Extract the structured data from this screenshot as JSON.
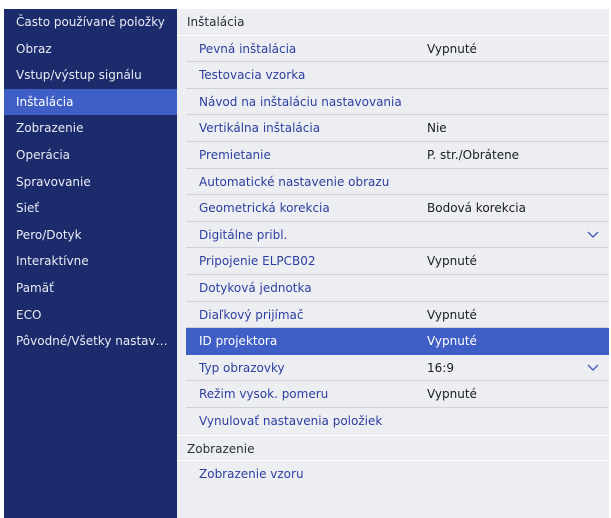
{
  "sidebar": {
    "items": [
      {
        "label": "Často používané položky",
        "selected": false
      },
      {
        "label": "Obraz",
        "selected": false
      },
      {
        "label": "Vstup/výstup signálu",
        "selected": false
      },
      {
        "label": "Inštalácia",
        "selected": true
      },
      {
        "label": "Zobrazenie",
        "selected": false
      },
      {
        "label": "Operácia",
        "selected": false
      },
      {
        "label": "Spravovanie",
        "selected": false
      },
      {
        "label": "Sieť",
        "selected": false
      },
      {
        "label": "Pero/Dotyk",
        "selected": false
      },
      {
        "label": "Interaktívne",
        "selected": false
      },
      {
        "label": "Pamäť",
        "selected": false
      },
      {
        "label": "ECO",
        "selected": false
      },
      {
        "label": "Pôvodné/Všetky nastavenia",
        "selected": false
      }
    ]
  },
  "main": {
    "section_title": "Inštalácia",
    "rows": [
      {
        "label": "Pevná inštalácia",
        "value": "Vypnuté"
      },
      {
        "label": "Testovacia vzorka",
        "value": ""
      },
      {
        "label": "Návod na inštaláciu nastavovania",
        "value": ""
      },
      {
        "label": "Vertikálna inštalácia",
        "value": "Nie"
      },
      {
        "label": "Premietanie",
        "value": "P. str./Obrátene"
      },
      {
        "label": "Automatické nastavenie obrazu",
        "value": ""
      },
      {
        "label": "Geometrická korekcia",
        "value": "Bodová korekcia"
      },
      {
        "label": "Digitálne pribl.",
        "value": "",
        "expandable": true
      },
      {
        "label": "Pripojenie ELPCB02",
        "value": "Vypnuté"
      },
      {
        "label": "Dotyková jednotka",
        "value": ""
      },
      {
        "label": "Diaľkový prijímač",
        "value": "Vypnuté"
      },
      {
        "label": "ID projektora",
        "value": "Vypnuté",
        "selected": true
      },
      {
        "label": "Typ obrazovky",
        "value": "16:9",
        "expandable": true
      },
      {
        "label": "Režim vysok. pomeru",
        "value": "Vypnuté"
      },
      {
        "label": "Vynulovať nastavenia položiek",
        "value": ""
      }
    ],
    "next_section_title": "Zobrazenie",
    "next_rows": [
      {
        "label": "Zobrazenie vzoru",
        "value": ""
      }
    ]
  },
  "icons": {
    "expand": "chevron-down-icon"
  },
  "colors": {
    "sidebar_bg": "#1c2b6b",
    "selected_bg": "#3f5fc6",
    "main_bg": "#edeef2",
    "label_text": "#2c3fa0",
    "value_text": "#1a1d28"
  }
}
